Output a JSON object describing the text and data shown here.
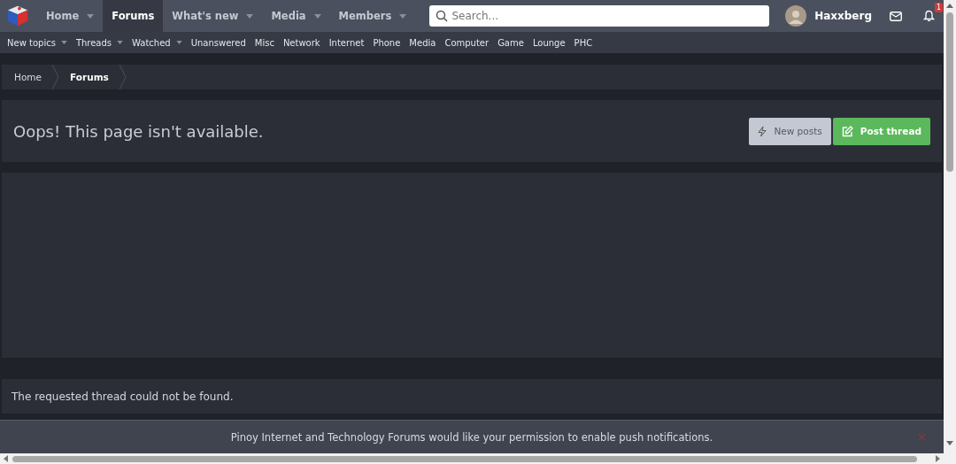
{
  "nav": {
    "tabs": [
      {
        "label": "Home",
        "selected": false,
        "dropdown": true
      },
      {
        "label": "Forums",
        "selected": true,
        "dropdown": false
      },
      {
        "label": "What's new",
        "selected": false,
        "dropdown": true
      },
      {
        "label": "Media",
        "selected": false,
        "dropdown": true
      },
      {
        "label": "Members",
        "selected": false,
        "dropdown": true
      }
    ],
    "search": {
      "placeholder": "Search..."
    },
    "user": {
      "name": "Haxxberg"
    },
    "alerts_badge": "1"
  },
  "subnav": [
    {
      "label": "New topics",
      "dropdown": true
    },
    {
      "label": "Threads",
      "dropdown": true
    },
    {
      "label": "Watched",
      "dropdown": true
    },
    {
      "label": "Unanswered",
      "dropdown": false
    },
    {
      "label": "Misc",
      "dropdown": false
    },
    {
      "label": "Network",
      "dropdown": false
    },
    {
      "label": "Internet",
      "dropdown": false
    },
    {
      "label": "Phone",
      "dropdown": false
    },
    {
      "label": "Media",
      "dropdown": false
    },
    {
      "label": "Computer",
      "dropdown": false
    },
    {
      "label": "Game",
      "dropdown": false
    },
    {
      "label": "Lounge",
      "dropdown": false
    },
    {
      "label": "PHC",
      "dropdown": false
    }
  ],
  "breadcrumb": [
    {
      "label": "Home",
      "current": false
    },
    {
      "label": "Forums",
      "current": true
    }
  ],
  "page_title": "Oops! This page isn't available.",
  "buttons": [
    {
      "label": "New posts",
      "kind": "secondary"
    },
    {
      "label": "Post thread",
      "kind": "primary"
    }
  ],
  "message": "The requested thread could not be found.",
  "push_notice": "Pinoy Internet and Technology Forums would like your permission to enable push notifications."
}
